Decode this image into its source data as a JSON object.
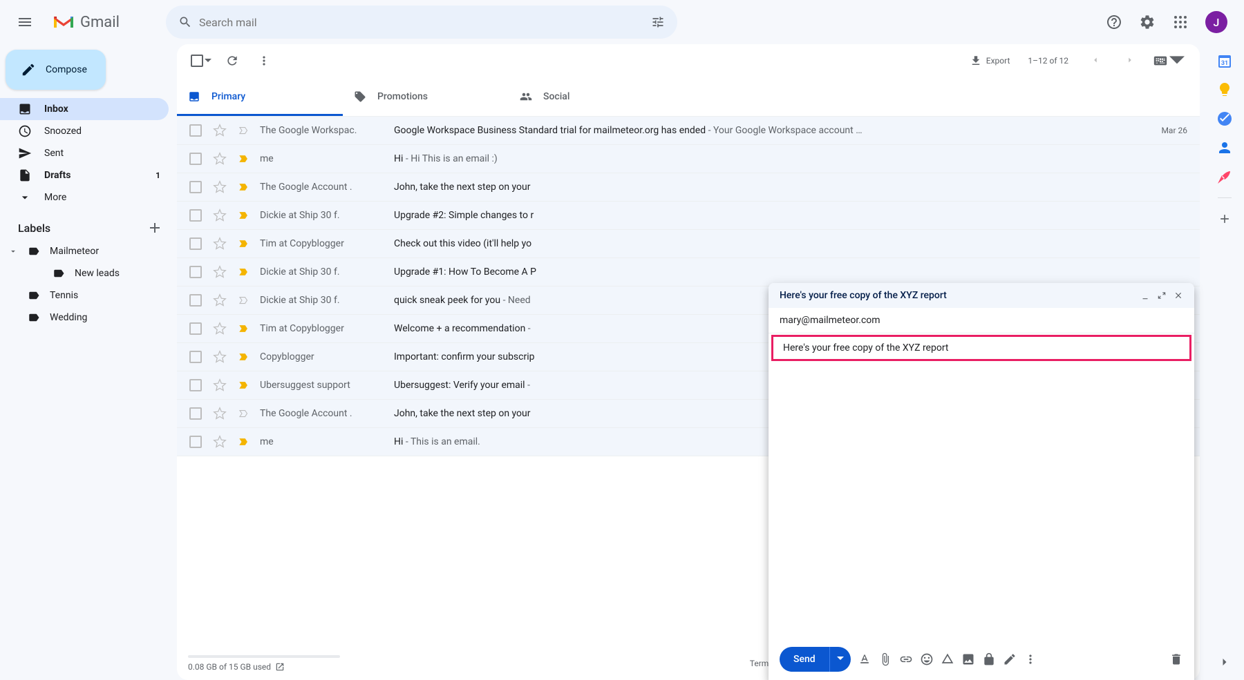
{
  "app": {
    "title": "Gmail"
  },
  "search": {
    "placeholder": "Search mail"
  },
  "avatar": {
    "initial": "J"
  },
  "compose_btn": "Compose",
  "nav": {
    "inbox": "Inbox",
    "snoozed": "Snoozed",
    "sent": "Sent",
    "drafts": "Drafts",
    "drafts_count": "1",
    "more": "More"
  },
  "labels": {
    "header": "Labels",
    "items": [
      {
        "name": "Mailmeteor",
        "has_children": true
      },
      {
        "name": "New leads",
        "indent": true
      },
      {
        "name": "Tennis"
      },
      {
        "name": "Wedding"
      }
    ]
  },
  "toolbar": {
    "export": "Export",
    "pagination": "1–12 of 12"
  },
  "tabs": {
    "primary": "Primary",
    "promotions": "Promotions",
    "social": "Social"
  },
  "rows": [
    {
      "sender": "The Google Workspac.",
      "subject": "Google Workspace Business Standard trial for mailmeteor.org has ended",
      "snippet": " - Your Google Workspace account …",
      "date": "Mar 26",
      "imp": false
    },
    {
      "sender": "me",
      "subject": "Hi",
      "snippet": " - Hi This is an email :)",
      "imp": true
    },
    {
      "sender": "The Google Account .",
      "subject": "John, take the next step on your",
      "snippet": "",
      "imp": true
    },
    {
      "sender": "Dickie at Ship 30 f.",
      "subject": "Upgrade #2: Simple changes to r",
      "snippet": "",
      "imp": true
    },
    {
      "sender": "Tim at Copyblogger",
      "subject": "Check out this video (it'll help yo",
      "snippet": "",
      "imp": true
    },
    {
      "sender": "Dickie at Ship 30 f.",
      "subject": "Upgrade #1: How To Become A P",
      "snippet": "",
      "imp": true
    },
    {
      "sender": "Dickie at Ship 30 f.",
      "subject": "quick sneak peek for you",
      "snippet": " - Need",
      "imp": false
    },
    {
      "sender": "Tim at Copyblogger",
      "subject": "Welcome + a recommendation",
      "snippet": " - ",
      "imp": true
    },
    {
      "sender": "Copyblogger",
      "subject": "Important: confirm your subscrip",
      "snippet": "",
      "imp": true
    },
    {
      "sender": "Ubersuggest support",
      "subject": "Ubersuggest: Verify your email",
      "snippet": " - ",
      "imp": true
    },
    {
      "sender": "The Google Account .",
      "subject": "John, take the next step on your",
      "snippet": "",
      "imp": false
    },
    {
      "sender": "me",
      "subject": "Hi",
      "snippet": " - This is an email.",
      "imp": true
    }
  ],
  "footer": {
    "storage": "0.08 GB of 15 GB used",
    "terms": "Terms · P"
  },
  "compose": {
    "title": "Here's your free copy of the XYZ report",
    "to": "mary@mailmeteor.com",
    "subject": "Here's your free copy of the XYZ report",
    "send": "Send"
  }
}
